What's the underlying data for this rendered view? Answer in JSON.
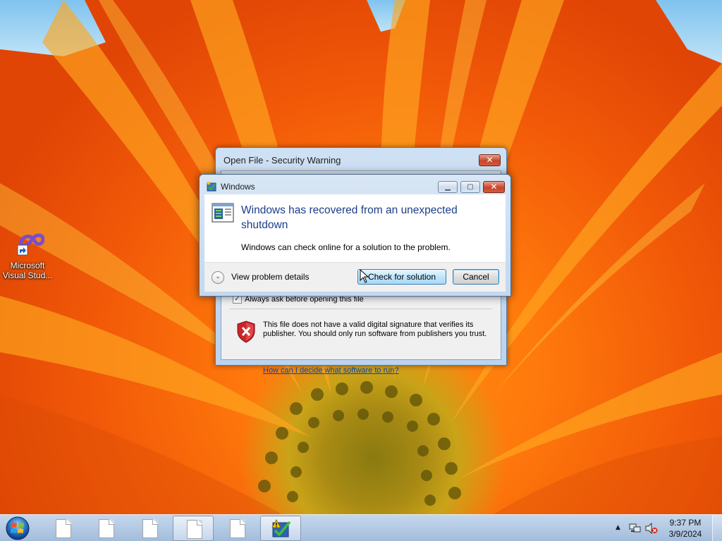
{
  "desktop": {
    "icons": [
      {
        "label_line1": "Microsoft",
        "label_line2": "Visual Stud...",
        "icon": "visual-studio-icon"
      }
    ]
  },
  "security_window": {
    "title": "Open File - Security Warning",
    "close_label": "✕",
    "checkbox_label": "Always ask before opening this file",
    "checkbox_checked": true,
    "warning_text": "This file does not have a valid digital signature that verifies its publisher.  You should only run software from publishers you trust.",
    "link_text": "How can I decide what software to run?",
    "shield_icon": "red-shield-x-icon"
  },
  "windows_dialog": {
    "title": "Windows",
    "heading": "Windows has recovered from an unexpected shutdown",
    "description": "Windows can check online for a solution to the problem.",
    "details_label": "View problem details",
    "check_button": "Check for solution",
    "cancel_button": "Cancel",
    "min_label": "▁",
    "max_label": "▢",
    "close_label": "✕"
  },
  "taskbar": {
    "items": [
      {
        "icon": "document-icon",
        "active": false
      },
      {
        "icon": "document-icon",
        "active": false
      },
      {
        "icon": "document-icon",
        "active": false
      },
      {
        "icon": "document-icon",
        "active": true
      },
      {
        "icon": "document-icon",
        "active": false
      },
      {
        "icon": "problem-reports-icon",
        "active": true
      }
    ],
    "tray": {
      "time": "9:37 PM",
      "date": "3/9/2024",
      "arrow_label": "▲"
    }
  },
  "colors": {
    "heading_blue": "#1c3d8c",
    "link_blue": "#0645ad",
    "close_red": "#c7452a"
  }
}
